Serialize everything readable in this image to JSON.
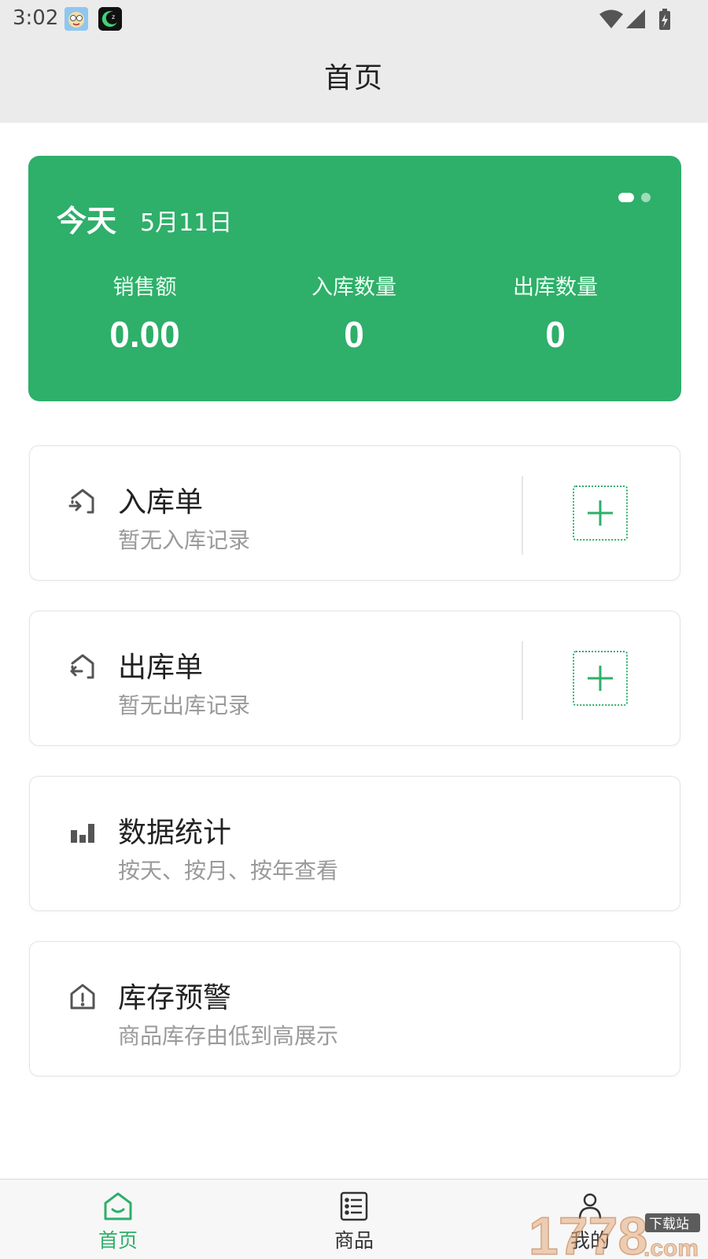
{
  "status_bar": {
    "time": "3:02",
    "icons": [
      "face-app-icon",
      "moon-app-icon",
      "wifi-icon",
      "signal-icon",
      "battery-charging-icon"
    ]
  },
  "header": {
    "title": "首页"
  },
  "today_card": {
    "label": "今天",
    "date": "5月11日",
    "page_indicator": {
      "total": 2,
      "active": 1
    },
    "stats": [
      {
        "label": "销售额",
        "value": "0.00"
      },
      {
        "label": "入库数量",
        "value": "0"
      },
      {
        "label": "出库数量",
        "value": "0"
      }
    ]
  },
  "menu": [
    {
      "title": "入库单",
      "subtitle": "暂无入库记录",
      "icon": "stock-in-icon",
      "has_add": true
    },
    {
      "title": "出库单",
      "subtitle": "暂无出库记录",
      "icon": "stock-out-icon",
      "has_add": true
    },
    {
      "title": "数据统计",
      "subtitle": "按天、按月、按年查看",
      "icon": "bar-chart-icon",
      "has_add": false
    },
    {
      "title": "库存预警",
      "subtitle": "商品库存由低到高展示",
      "icon": "warning-house-icon",
      "has_add": false
    }
  ],
  "tabs": [
    {
      "label": "首页",
      "icon": "home-icon",
      "active": true
    },
    {
      "label": "商品",
      "icon": "list-icon",
      "active": false
    },
    {
      "label": "我的",
      "icon": "person-icon",
      "active": false
    }
  ],
  "watermark": {
    "text": "1778",
    "subtext": "下载站",
    "suffix": ".com"
  },
  "colors": {
    "accent": "#2eaf6a",
    "header_bg": "#ebebeb",
    "muted_text": "#9a9a9a"
  }
}
